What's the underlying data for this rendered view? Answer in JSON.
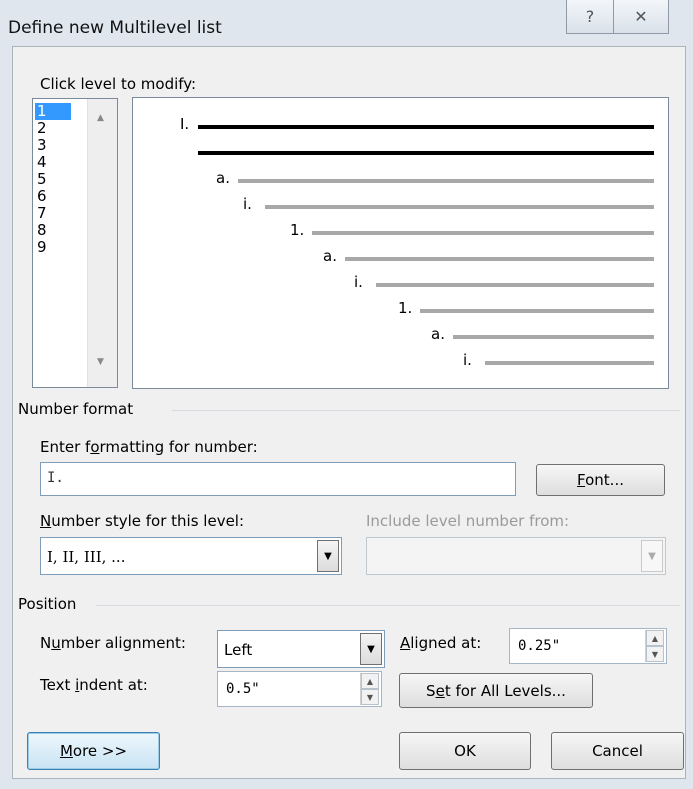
{
  "window": {
    "title": "Define new Multilevel list",
    "help_icon": "help-icon",
    "close_icon": "close-icon"
  },
  "level_picker": {
    "label": "Click level to modify:",
    "levels": [
      "1",
      "2",
      "3",
      "4",
      "5",
      "6",
      "7",
      "8",
      "9"
    ],
    "selected": "1"
  },
  "preview": {
    "labels": [
      "I.",
      "a.",
      "i.",
      "1.",
      "a.",
      "i.",
      "1.",
      "a.",
      "i."
    ],
    "colors": {
      "active": "#000000",
      "inactive": "#a8a8a8"
    }
  },
  "number_format": {
    "section": "Number format",
    "enter_label": "Enter formatting for number:",
    "value": "I.",
    "font_button": "Font...",
    "style_label": "Number style for this level:",
    "style_value": "I, II, III, ...",
    "include_label": "Include level number from:",
    "include_value": ""
  },
  "position": {
    "section": "Position",
    "alignment_label": "Number alignment:",
    "alignment_value": "Left",
    "aligned_at_label": "Aligned at:",
    "aligned_at_value": "0.25\"",
    "indent_label": "Text indent at:",
    "indent_value": "0.5\"",
    "set_all_button": "Set for All Levels..."
  },
  "footer": {
    "more": "More >>",
    "ok": "OK",
    "cancel": "Cancel"
  }
}
